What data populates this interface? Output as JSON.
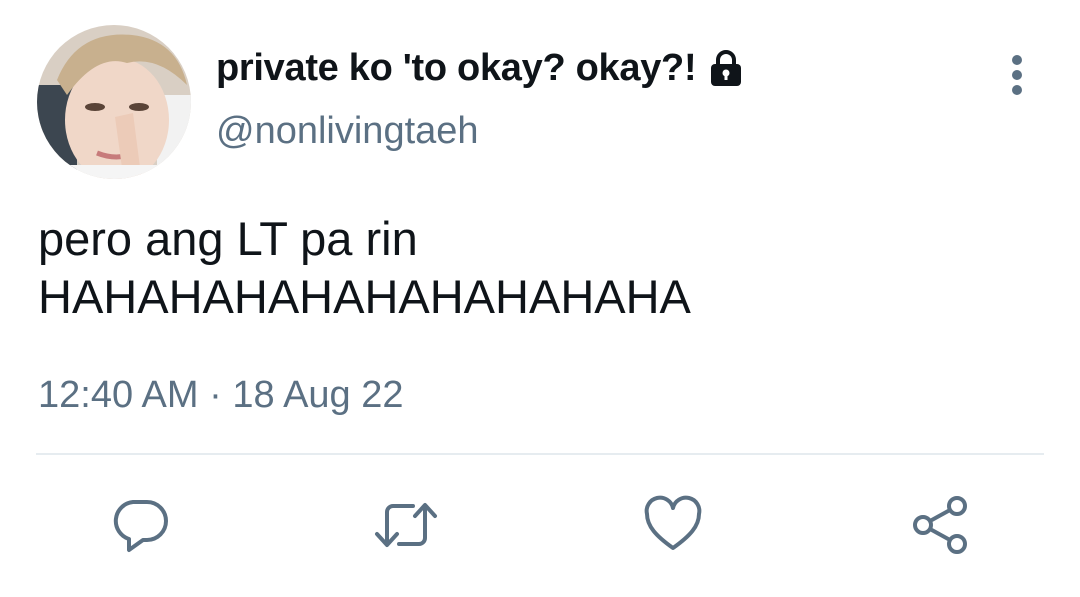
{
  "user": {
    "display_name": "private ko 'to okay? okay?!",
    "handle": "@nonlivingtaeh",
    "protected_icon": "lock-icon"
  },
  "tweet": {
    "text": "pero ang LT pa rin\nHAHAHAHAHAHAHAHAHAHA",
    "time": "12:40 AM",
    "separator": "·",
    "date": "18 Aug 22"
  },
  "actions": {
    "icons": [
      "reply-icon",
      "retweet-icon",
      "like-icon",
      "share-icon"
    ],
    "menu_icon": "more-vertical-icon"
  },
  "colors": {
    "text_primary": "#0f1419",
    "text_secondary": "#5b7083",
    "icon": "#5b7083",
    "divider": "#e6ecf0"
  }
}
